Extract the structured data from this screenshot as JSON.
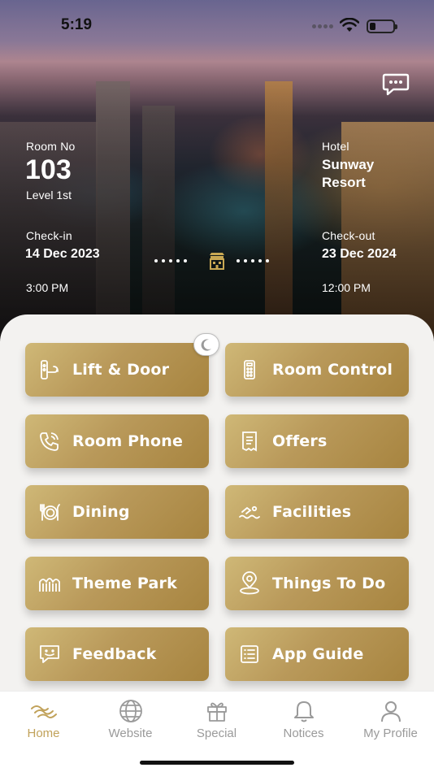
{
  "status_bar": {
    "time": "5:19"
  },
  "hero": {
    "room_label": "Room No",
    "room_number": "103",
    "level": "Level 1st",
    "hotel_label": "Hotel",
    "hotel_name": "Sunway Resort",
    "checkin_label": "Check-in",
    "checkin_date": "14 Dec 2023",
    "checkin_time": "3:00 PM",
    "checkout_label": "Check-out",
    "checkout_date": "23 Dec 2024",
    "checkout_time": "12:00 PM"
  },
  "tiles": [
    {
      "label": "Lift & Door",
      "icon": "lift-door-icon"
    },
    {
      "label": "Room Control",
      "icon": "room-control-icon"
    },
    {
      "label": "Room Phone",
      "icon": "phone-icon"
    },
    {
      "label": "Offers",
      "icon": "offers-icon"
    },
    {
      "label": "Dining",
      "icon": "dining-icon"
    },
    {
      "label": "Facilities",
      "icon": "facilities-icon"
    },
    {
      "label": "Theme Park",
      "icon": "theme-park-icon"
    },
    {
      "label": "Things To Do",
      "icon": "location-pin-icon"
    },
    {
      "label": "Feedback",
      "icon": "feedback-icon"
    },
    {
      "label": "App Guide",
      "icon": "app-guide-icon"
    }
  ],
  "tabs": [
    {
      "label": "Home",
      "icon": "home-logo-icon",
      "active": true
    },
    {
      "label": "Website",
      "icon": "globe-icon",
      "active": false
    },
    {
      "label": "Special",
      "icon": "gift-icon",
      "active": false
    },
    {
      "label": "Notices",
      "icon": "bell-icon",
      "active": false
    },
    {
      "label": "My Profile",
      "icon": "user-icon",
      "active": false
    }
  ],
  "colors": {
    "gold": "#c1a25a",
    "tile_gold": "#b9995a",
    "tab_inactive": "#9a9a9a"
  }
}
